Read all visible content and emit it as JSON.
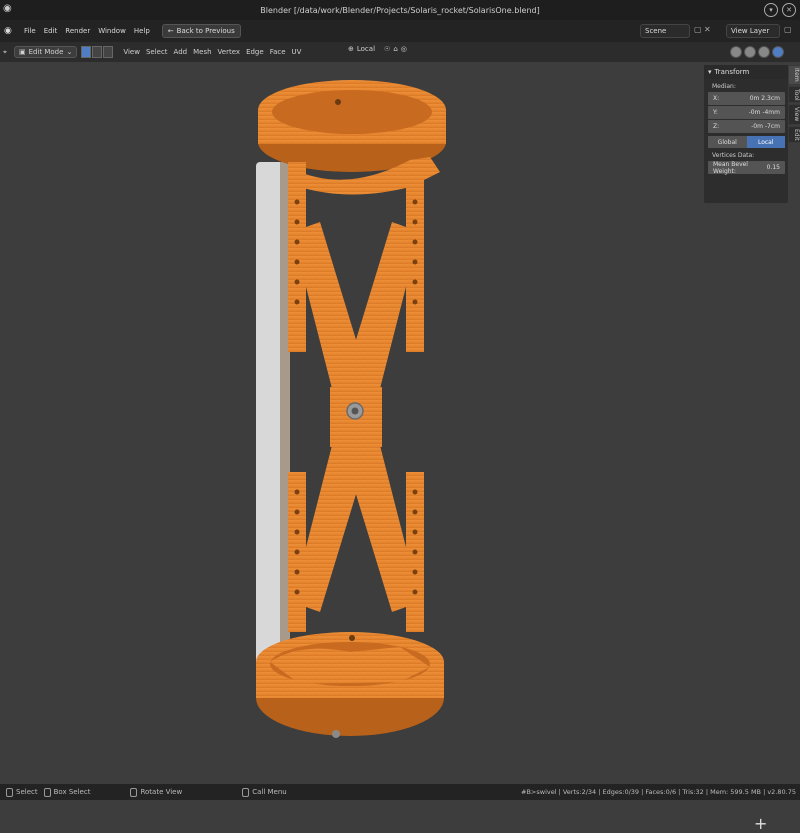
{
  "window": {
    "title": "Blender [/data/work/Blender/Projects/Solaris_rocket/SolarisOne.blend]"
  },
  "menubar": {
    "items": [
      "File",
      "Edit",
      "Render",
      "Window",
      "Help"
    ],
    "back_button": "Back to Previous",
    "scene": "Scene",
    "view_layer": "View Layer"
  },
  "header": {
    "mode": "Edit Mode",
    "items": [
      "View",
      "Select",
      "Add",
      "Mesh",
      "Vertex",
      "Edge",
      "Face",
      "UV"
    ],
    "orientation": "Local"
  },
  "npanel": {
    "title": "Transform",
    "median_label": "Median:",
    "fields": [
      {
        "label": "X:",
        "value": "0m 2.3cm"
      },
      {
        "label": "Y:",
        "value": "-0m -4mm"
      },
      {
        "label": "Z:",
        "value": "-0m -7cm"
      }
    ],
    "toggle": {
      "global": "Global",
      "local": "Local"
    },
    "vertices_label": "Vertices Data:",
    "bevel": {
      "label": "Mean Bevel Weight:",
      "value": "0.15"
    },
    "tabs": [
      "Item",
      "Tool",
      "View",
      "Edit"
    ]
  },
  "status": {
    "select": "Select",
    "box_select": "Box Select",
    "rotate": "Rotate View",
    "call_menu": "Call Menu",
    "stats": "#B>swivel | Verts:2/34 | Edges:0/39 | Faces:0/6 | Tris:32 | Mem: 599.5 MB | v2.80.75"
  },
  "colors": {
    "part": "#e8862f",
    "part_dark": "#b8611a",
    "panel_white": "#d8d8d8",
    "accent": "#4772b3"
  }
}
